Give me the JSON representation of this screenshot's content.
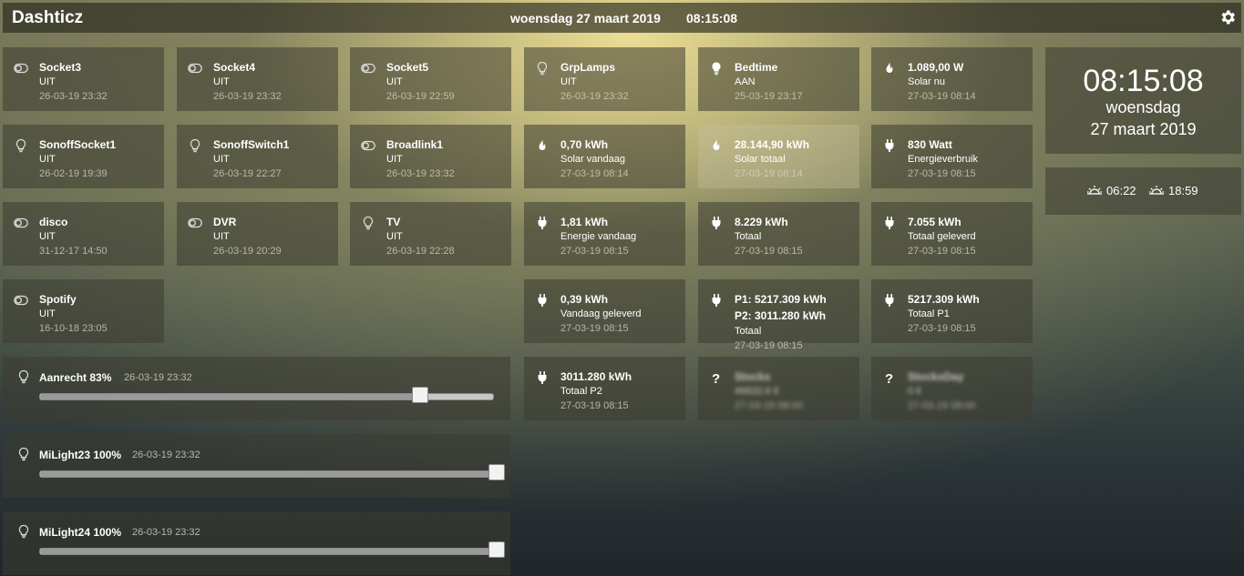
{
  "header": {
    "brand": "Dashticz",
    "date": "woensdag 27 maart 2019",
    "time": "08:15:08",
    "settings_icon": "gear-icon"
  },
  "tiles": [
    {
      "title": "Socket3",
      "sub": "UIT",
      "time": "26-03-19 23:32",
      "icon": "toggle-icon"
    },
    {
      "title": "Socket4",
      "sub": "UIT",
      "time": "26-03-19 23:32",
      "icon": "toggle-icon"
    },
    {
      "title": "Socket5",
      "sub": "UIT",
      "time": "26-03-19 22:59",
      "icon": "toggle-icon"
    },
    {
      "title": "GrpLamps",
      "sub": "UIT",
      "time": "26-03-19 23:32",
      "icon": "bulb-icon"
    },
    {
      "title": "Bedtime",
      "sub": "AAN",
      "time": "25-03-19 23:17",
      "icon": "bulb-icon"
    },
    {
      "title": "1.089,00 W",
      "sub": "Solar nu",
      "time": "27-03-19 08:14",
      "icon": "flame-icon"
    },
    {
      "title": "SonoffSocket1",
      "sub": "UIT",
      "time": "26-02-19 19:39",
      "icon": "bulb-icon"
    },
    {
      "title": "SonoffSwitch1",
      "sub": "UIT",
      "time": "26-03-19 22:27",
      "icon": "bulb-icon"
    },
    {
      "title": "Broadlink1",
      "sub": "UIT",
      "time": "26-03-19 23:32",
      "icon": "toggle-icon"
    },
    {
      "title": "0,70 kWh",
      "sub": "Solar vandaag",
      "time": "27-03-19 08:14",
      "icon": "flame-icon"
    },
    {
      "title": "28.144,90 kWh",
      "sub": "Solar totaal",
      "time": "27-03-19 08:14",
      "icon": "flame-icon"
    },
    {
      "title": "830 Watt",
      "sub": "Energieverbruik",
      "time": "27-03-19 08:15",
      "icon": "plug-icon"
    },
    {
      "title": "disco",
      "sub": "UIT",
      "time": "31-12-17 14:50",
      "icon": "toggle-icon"
    },
    {
      "title": "DVR",
      "sub": "UIT",
      "time": "26-03-19 20:29",
      "icon": "toggle-icon"
    },
    {
      "title": "TV",
      "sub": "UIT",
      "time": "26-03-19 22:28",
      "icon": "bulb-icon"
    },
    {
      "title": "1,81 kWh",
      "sub": "Energie vandaag",
      "time": "27-03-19 08:15",
      "icon": "plug-icon"
    },
    {
      "title": "8.229 kWh",
      "sub": "Totaal",
      "time": "27-03-19 08:15",
      "icon": "plug-icon"
    },
    {
      "title": "7.055 kWh",
      "sub": "Totaal geleverd",
      "time": "27-03-19 08:15",
      "icon": "plug-icon"
    },
    {
      "title": "Spotify",
      "sub": "UIT",
      "time": "16-10-18 23:05",
      "icon": "toggle-icon"
    },
    {
      "title": "0,39 kWh",
      "sub": "Vandaag geleverd",
      "time": "27-03-19 08:15",
      "icon": "plug-icon"
    },
    {
      "title": "P1: 5217.309 kWh",
      "title2": "P2: 3011.280 kWh",
      "sub": "Totaal",
      "time": "27-03-19 08:15",
      "icon": "plug-icon"
    },
    {
      "title": "5217.309 kWh",
      "sub": "Totaal P1",
      "time": "27-03-19 08:15",
      "icon": "plug-icon"
    },
    {
      "title": "3011.280 kWh",
      "sub": "Totaal P2",
      "time": "27-03-19 08:15",
      "icon": "plug-icon"
    },
    {
      "title": "Stocks",
      "sub": "46632.6 €",
      "time": "27-03-19 08:00",
      "icon": "question-icon"
    },
    {
      "title": "StocksDay",
      "sub": "0 €",
      "time": "27-03-19 08:00",
      "icon": "question-icon"
    }
  ],
  "dimmers": [
    {
      "title": "Aanrecht 83%",
      "time": "26-03-19 23:32",
      "level": 83
    },
    {
      "title": "MiLight23 100%",
      "time": "26-03-19 23:32",
      "level": 100
    },
    {
      "title": "MiLight24 100%",
      "time": "26-03-19 23:32",
      "level": 100
    }
  ],
  "clock": {
    "time": "08:15:08",
    "day": "woensdag",
    "date": "27 maart 2019"
  },
  "sun": {
    "sunrise": "06:22",
    "sunset": "18:59",
    "sunrise_icon": "sunrise-icon",
    "sunset_icon": "sunset-icon"
  }
}
